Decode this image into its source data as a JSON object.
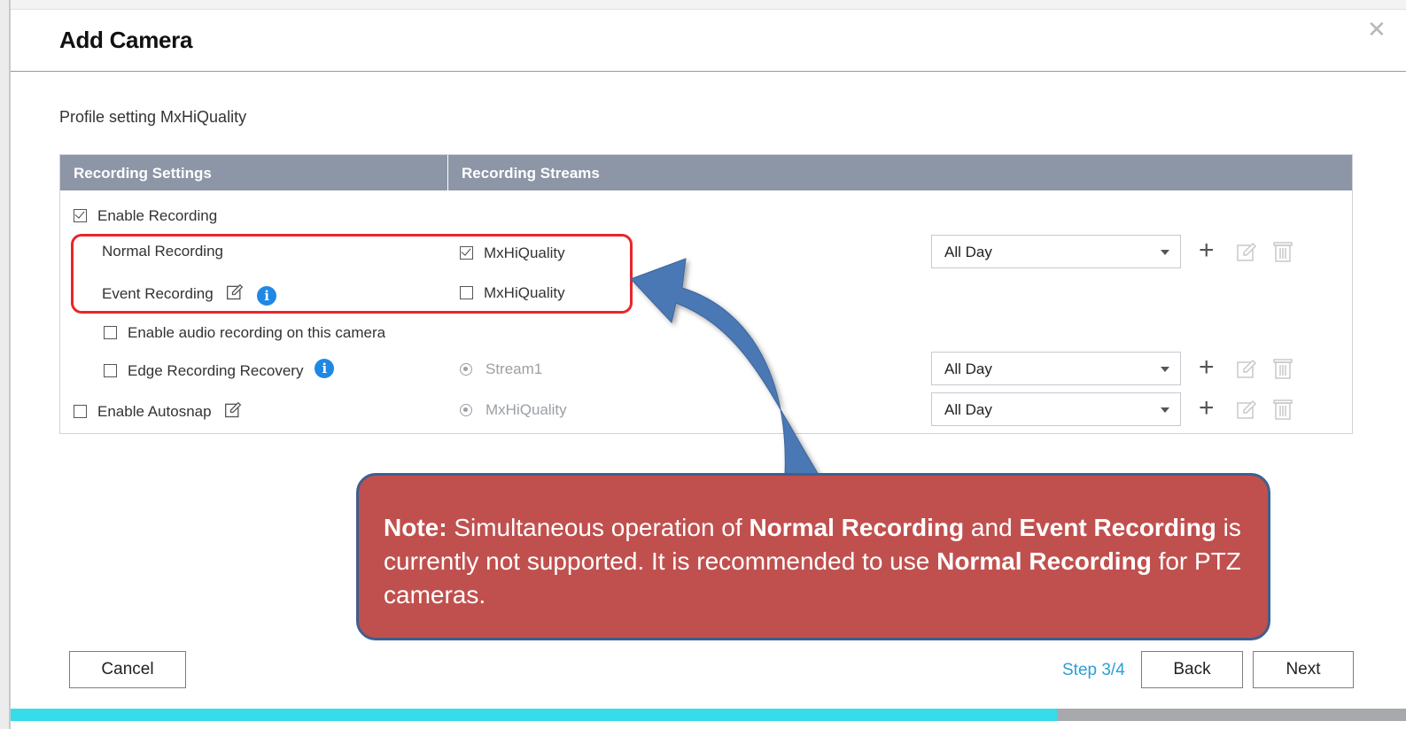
{
  "dialog": {
    "title": "Add Camera",
    "profile_label": "Profile setting MxHiQuality"
  },
  "table": {
    "headers": [
      "Recording Settings",
      "Recording Streams"
    ],
    "enable_recording": {
      "label": "Enable Recording",
      "checked": true
    },
    "normal_recording": {
      "label": "Normal Recording",
      "stream": "MxHiQuality",
      "stream_checked": true,
      "schedule": "All Day"
    },
    "event_recording": {
      "label": "Event Recording",
      "stream": "MxHiQuality",
      "stream_checked": false
    },
    "audio_recording": {
      "label": "Enable audio recording on this camera",
      "checked": false
    },
    "edge_recovery": {
      "label": "Edge Recording Recovery",
      "checked": false,
      "stream": "Stream1",
      "schedule": "All Day"
    },
    "autosnap": {
      "label": "Enable Autosnap",
      "checked": false,
      "stream": "MxHiQuality",
      "schedule": "All Day"
    }
  },
  "note": {
    "prefix": "Note:",
    "t1": " Simultaneous operation of ",
    "b1": "Normal Recording",
    "t2": " and ",
    "b2": "Event Recording",
    "t3": " is currently not supported. It is recommended to use ",
    "b3": "Normal Recording",
    "t4": " for PTZ cameras."
  },
  "footer": {
    "cancel_label": "Cancel",
    "step_label": "Step 3/4",
    "back_label": "Back",
    "next_label": "Next",
    "progress_fraction": 0.75
  },
  "colors": {
    "header_bg": "#8d96a6",
    "highlight": "#e8262b",
    "note_bg": "#c0504e",
    "arrow": "#4a78b5",
    "info_blue": "#1e88e5",
    "step_text": "#2a9fd8",
    "progress": "#36dde8"
  },
  "icons": [
    "close-icon",
    "edit-icon",
    "info-icon",
    "plus-icon",
    "delete-icon",
    "checkbox",
    "radio",
    "chevron-down-icon"
  ]
}
